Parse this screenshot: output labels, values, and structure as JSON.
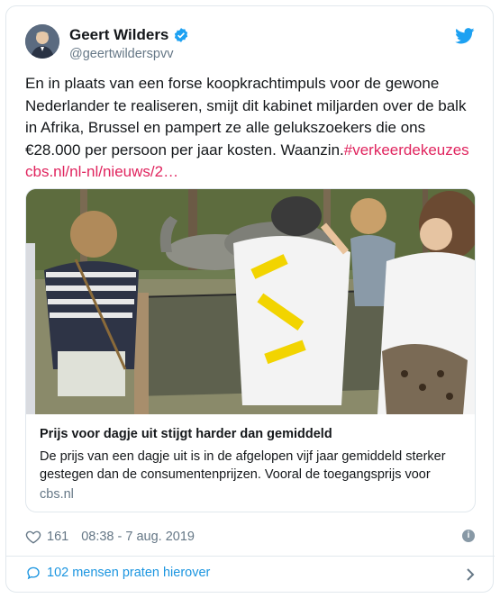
{
  "tweet": {
    "author_name": "Geert Wilders",
    "handle": "@geertwilderspvv",
    "text_plain": "En in plaats van een forse koopkrachtimpuls voor de gewone Nederlander te realiseren, smijt dit kabinet miljarden over de balk in Afrika, Brussel en pampert ze alle gelukszoekers die ons €28.000 per persoon per jaar kosten. Waanzin.",
    "hashtag": "#verkeerdekeuzes",
    "url": "cbs.nl/nl-nl/nieuws/2…",
    "likes": "161",
    "timestamp": "08:38 - 7 aug. 2019",
    "replies_label": "102 mensen praten hierover"
  },
  "link_card": {
    "title": "Prijs voor dagje uit stijgt harder dan gemiddeld",
    "description": "De prijs van een dagje uit is in de afgelopen vijf jaar gemiddeld sterker gestegen dan de consumentenprijzen. Vooral de toegangsprijs voor",
    "domain": "cbs.nl"
  },
  "colors": {
    "link": "#e0245e",
    "twitter_blue": "#1da1f2",
    "muted": "#657786"
  }
}
